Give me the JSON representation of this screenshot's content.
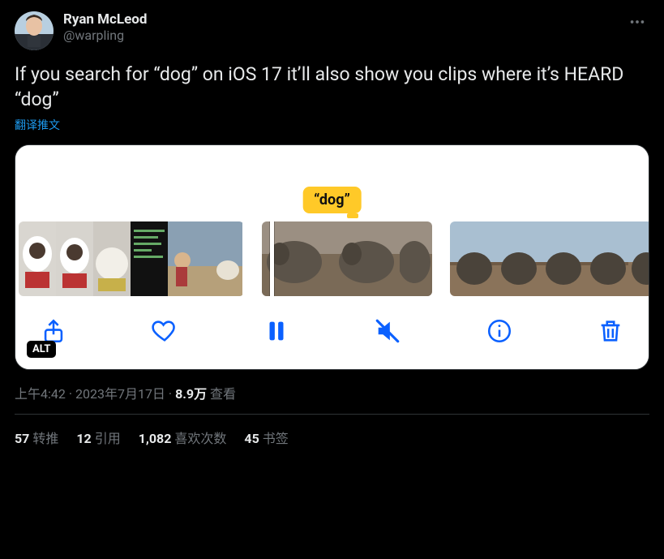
{
  "author": {
    "display_name": "Ryan McLeod",
    "handle": "@warpling"
  },
  "body_text": "If you search for “dog” on iOS 17 it’ll also show you clips where it’s HEARD “dog”",
  "translate_label": "翻译推文",
  "media": {
    "search_term": "“dog”",
    "alt_badge": "ALT",
    "toolbar": {
      "share": "share",
      "like": "like",
      "pause": "pause",
      "mute": "mute",
      "info": "info",
      "delete": "delete"
    }
  },
  "meta": {
    "time": "上午4:42",
    "sep1": " · ",
    "date": "2023年7月17日",
    "sep2": " · ",
    "views_num": "8.9万",
    "views_label": " 查看"
  },
  "stats": {
    "retweets_num": "57",
    "retweets_label": "转推",
    "quotes_num": "12",
    "quotes_label": "引用",
    "likes_num": "1,082",
    "likes_label": "喜欢次数",
    "bookmarks_num": "45",
    "bookmarks_label": "书签"
  }
}
